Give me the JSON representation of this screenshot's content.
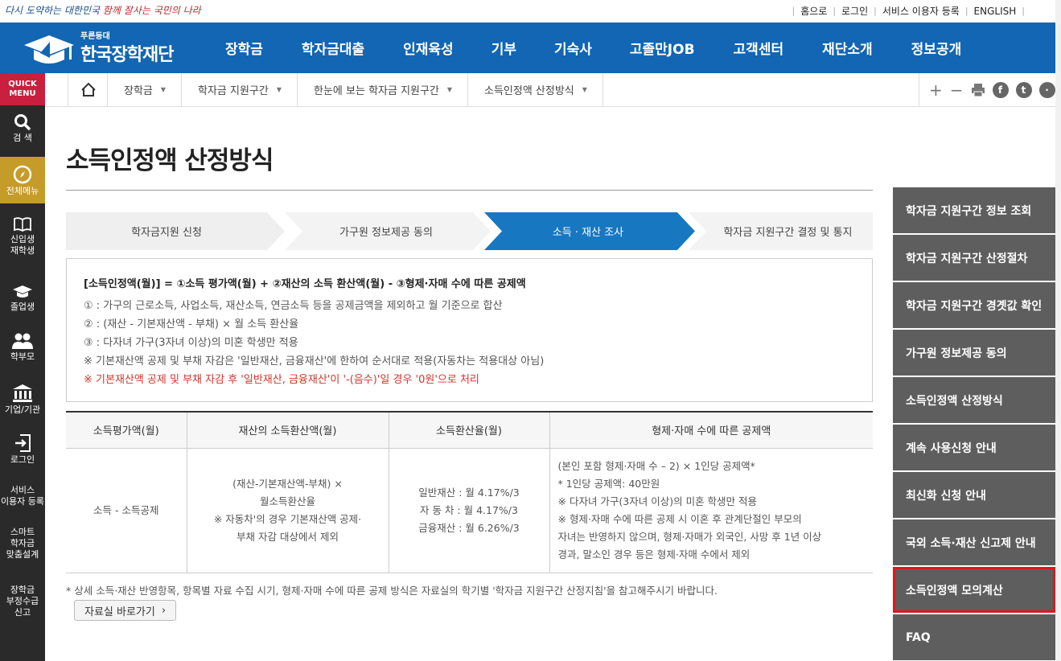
{
  "topbar": {
    "slogan_a": "다시 도약하는 대한민국",
    "slogan_b": "함께 잘사는 국민의 나라",
    "links": [
      "홈으로",
      "로그인",
      "서비스 이용자 등록",
      "ENGLISH"
    ]
  },
  "header": {
    "logo_tag": "푸른등대",
    "logo_name": "한국장학재단",
    "nav": [
      "장학금",
      "학자금대출",
      "인재육성",
      "기부",
      "기숙사",
      "고졸만JOB",
      "고객센터",
      "재단소개",
      "정보공개"
    ]
  },
  "quick_menu": {
    "title": "QUICK MENU",
    "items": [
      {
        "label": "검 색",
        "icon": "search-icon"
      },
      {
        "label": "전체메뉴",
        "icon": "compass-icon"
      },
      {
        "label": "신입생\n재학생",
        "icon": "book-icon"
      },
      {
        "label": "졸업생",
        "icon": "graduation-cap-icon"
      },
      {
        "label": "학부모",
        "icon": "people-icon"
      },
      {
        "label": "기업/기관",
        "icon": "building-icon"
      },
      {
        "label": "로그인",
        "icon": "login-icon"
      },
      {
        "label": "서비스\n이용자 등록",
        "icon": ""
      },
      {
        "label": "스마트\n학자금\n맞춤설계",
        "icon": ""
      },
      {
        "label": "장학금\n부정수급\n신고",
        "icon": ""
      }
    ]
  },
  "breadcrumb": {
    "items": [
      "장학금",
      "학자금 지원구간",
      "한눈에 보는 학자금 지원구간",
      "소득인정액 산정방식"
    ]
  },
  "page": {
    "title": "소득인정액 산정방식"
  },
  "steps": {
    "items": [
      "학자금지원 신청",
      "가구원 정보제공 동의",
      "소득 · 재산 조사",
      "학자금 지원구간 결정 및 통지"
    ],
    "active_index": 2
  },
  "formula": {
    "main": "[소득인정액(월)] = ①소득 평가액(월) + ②재산의 소득 환산액(월) - ③형제·자매 수에 따른 공제액",
    "lines": [
      "① : 가구의 근로소득, 사업소득, 재산소득, 연금소득 등을 공제금액을 제외하고 월 기준으로 합산",
      "② : (재산 - 기본재산액 - 부채) × 월 소득 환산율",
      "③ : 다자녀 가구(3자녀 이상)의 미혼 학생만 적용",
      "※ 기본재산액 공제 및 부채 자감은 '일반재산, 금융재산'에 한하여 순서대로 적용(자동차는 적용대상 아님)"
    ],
    "warning": "※ 기본재산액 공제 및 부채 자감 후 '일반재산, 금융재산'이 '-(음수)'일 경우 '0원'으로 처리"
  },
  "table": {
    "headers": [
      "소득평가액(월)",
      "재산의 소득환산액(월)",
      "소득환산율(월)",
      "형제·자매 수에 따른 공제액"
    ],
    "col1": "소득 - 소득공제",
    "col2": [
      "(재산-기본재산액-부채) ×",
      "월소득환산율",
      "※ 자동차'의 경우 기본재산액 공제·",
      "부채 자감 대상에서 제외"
    ],
    "col3": [
      "일반재산 : 월 4.17%/3",
      "자 동 차 : 월 4.17%/3",
      "금융재산 : 월 6.26%/3"
    ],
    "col4": [
      "(본인 포함 형제·자매 수 – 2) × 1인당 공제액*",
      "* 1인당 공제액: 40만원",
      "※ 다자녀 가구(3자녀 이상)의 미혼 학생만 적용",
      "※ 형제·자매 수에 따른 공제 시 이혼 후 관계단절인 부모의",
      "자녀는 반영하지 않으며, 형제·자매가 외국인, 사망 후 1년 이상",
      "경과, 말소인 경우 등은 형제·자매 수에서 제외"
    ]
  },
  "footnote": "* 상세 소득·재산 반영항목, 항목별 자료 수집 시기, 형제·자매 수에 따른 공제 방식은 자료실의 학기별 '학자금 지원구간 산정지침'을 참고해주시기 바랍니다.",
  "library_button": "자료실 바로가기",
  "side_menu": {
    "items": [
      "학자금 지원구간 정보 조회",
      "학자금 지원구간 산정절차",
      "학자금 지원구간 경곗값 확인",
      "가구원 정보제공 동의",
      "소득인정액 산정방식",
      "계속 사용신청 안내",
      "최신화 신청 안내",
      "국외 소득·재산 신고제 안내",
      "소득인정액 모의계산",
      "FAQ"
    ],
    "highlighted_index": 8
  },
  "colors": {
    "header_blue": "#1266b3",
    "step_active": "#1877c1",
    "quick_red": "#c8203e",
    "side_gray": "#5e5e5e",
    "highlight_red": "#e0171c",
    "warning_red": "#d2342b"
  }
}
